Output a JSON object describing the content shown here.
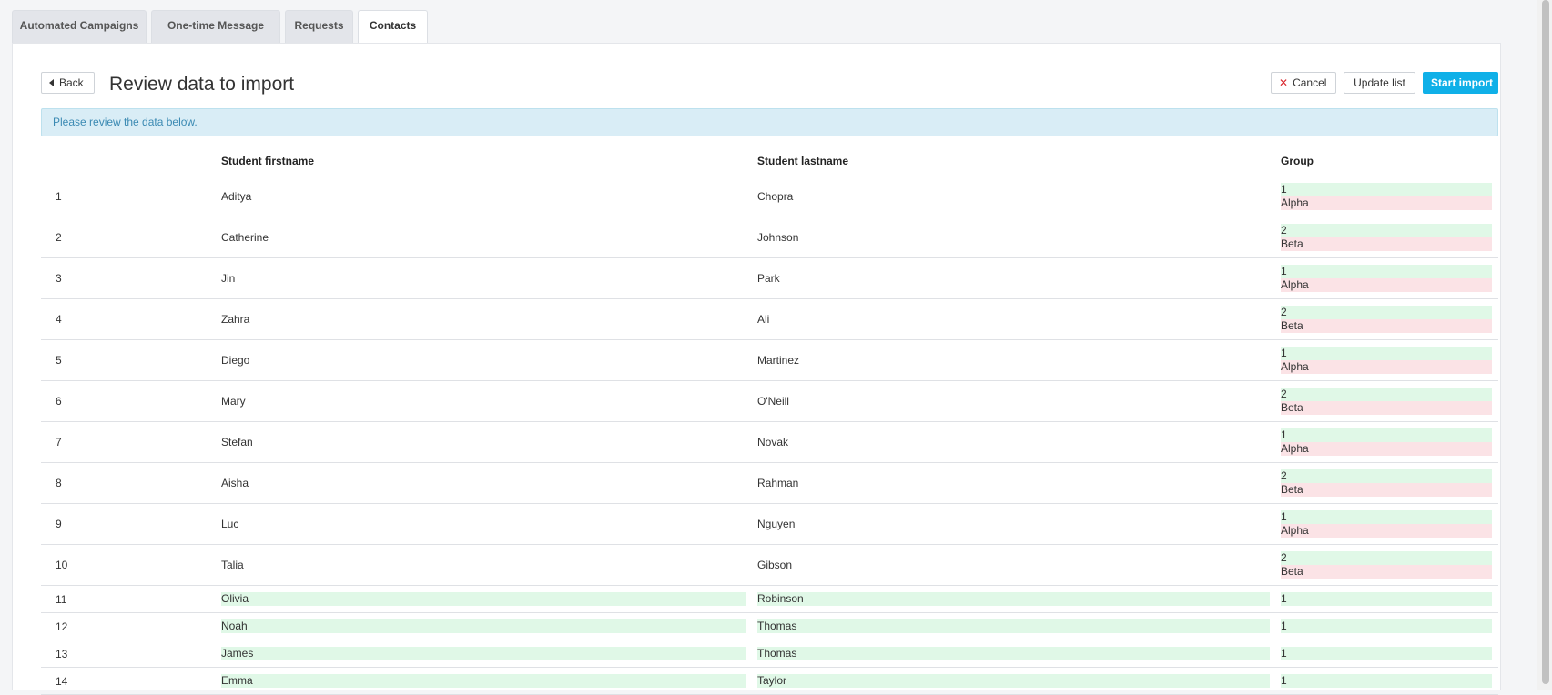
{
  "tabs": [
    {
      "label": "Automated Campaigns",
      "active": false
    },
    {
      "label": "One-time Message",
      "active": false
    },
    {
      "label": "Requests",
      "active": false
    },
    {
      "label": "Contacts",
      "active": true
    }
  ],
  "header": {
    "back_label": "Back",
    "title": "Review data to import",
    "cancel_label": "Cancel",
    "update_label": "Update list",
    "start_label": "Start import"
  },
  "alert": {
    "text": "Please review the data below."
  },
  "table": {
    "columns": [
      "",
      "Student firstname",
      "Student lastname",
      "Group"
    ],
    "rows": [
      {
        "num": "1",
        "first": "Aditya",
        "last": "Chopra",
        "group_new": "1",
        "group_old": "Alpha"
      },
      {
        "num": "2",
        "first": "Catherine",
        "last": "Johnson",
        "group_new": "2",
        "group_old": "Beta"
      },
      {
        "num": "3",
        "first": "Jin",
        "last": "Park",
        "group_new": "1",
        "group_old": "Alpha"
      },
      {
        "num": "4",
        "first": "Zahra",
        "last": "Ali",
        "group_new": "2",
        "group_old": "Beta"
      },
      {
        "num": "5",
        "first": "Diego",
        "last": "Martinez",
        "group_new": "1",
        "group_old": "Alpha"
      },
      {
        "num": "6",
        "first": "Mary",
        "last": "O'Neill",
        "group_new": "2",
        "group_old": "Beta"
      },
      {
        "num": "7",
        "first": "Stefan",
        "last": "Novak",
        "group_new": "1",
        "group_old": "Alpha"
      },
      {
        "num": "8",
        "first": "Aisha",
        "last": "Rahman",
        "group_new": "2",
        "group_old": "Beta"
      },
      {
        "num": "9",
        "first": "Luc",
        "last": "Nguyen",
        "group_new": "1",
        "group_old": "Alpha"
      },
      {
        "num": "10",
        "first": "Talia",
        "last": "Gibson",
        "group_new": "2",
        "group_old": "Beta"
      }
    ],
    "new_rows": [
      {
        "num": "11",
        "first": "Olivia",
        "last": "Robinson",
        "group": "1"
      },
      {
        "num": "12",
        "first": "Noah",
        "last": "Thomas",
        "group": "1"
      },
      {
        "num": "13",
        "first": "James",
        "last": "Thomas",
        "group": "1"
      },
      {
        "num": "14",
        "first": "Emma",
        "last": "Taylor",
        "group": "1"
      }
    ]
  },
  "colors": {
    "accent": "#0fb0e8",
    "added": "#e0f8e7",
    "removed": "#fbe3e6",
    "alert_bg": "#d9edf6"
  }
}
